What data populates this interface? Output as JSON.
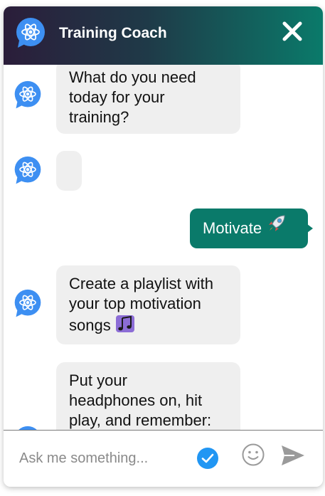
{
  "header": {
    "title": "Training Coach",
    "icons": {
      "avatar": "react-atom-chat-bubble-icon",
      "close": "close-x-icon"
    }
  },
  "messages": [
    {
      "from": "bot",
      "text_lines": [
        "What do you need",
        "today for your",
        "training?"
      ]
    },
    {
      "from": "bot",
      "text_lines": [],
      "state": "typing/empty"
    },
    {
      "from": "user",
      "text": "Motivate",
      "emoji": "rocket-emoji"
    },
    {
      "from": "bot",
      "text_lines": [
        "Create a playlist with",
        "your top motivation",
        "songs"
      ],
      "emoji": "music-notes-emoji"
    },
    {
      "from": "bot",
      "text_lines": [
        "Put your",
        "headphones on, hit",
        "play, and remember:"
      ]
    }
  ],
  "footer": {
    "placeholder": "Ask me something...",
    "icons": {
      "check": "check-circle-icon",
      "emoji": "smiley-icon",
      "send": "send-arrow-icon"
    }
  },
  "colors": {
    "header_gradient_start": "#2b1d3a",
    "header_gradient_end": "#0a7a6a",
    "bot_bubble": "#efefef",
    "user_bubble": "#0a7a6a",
    "avatar_blue": "#3d8ff2",
    "check_blue": "#2196f3"
  }
}
